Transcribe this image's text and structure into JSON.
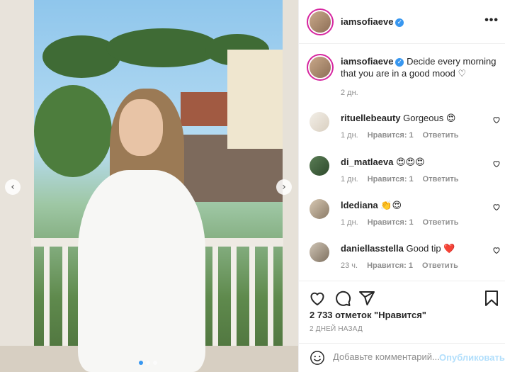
{
  "post": {
    "author": "iamsofiaeve",
    "verified_glyph": "✓",
    "more_glyph": "•••",
    "caption": "Decide every morning that you are in a good mood ♡",
    "caption_time": "2 дн."
  },
  "comments": [
    {
      "user": "rituellebeauty",
      "text": "Gorgeous 😍",
      "time": "1 дн.",
      "likes": "Нравится: 1",
      "reply": "Ответить"
    },
    {
      "user": "di_matlaeva",
      "text": "😍😍😍",
      "time": "1 дн.",
      "likes": "Нравится: 1",
      "reply": "Ответить"
    },
    {
      "user": "ldediana",
      "text": "👏😍",
      "time": "1 дн.",
      "likes": "Нравится: 1",
      "reply": "Ответить"
    },
    {
      "user": "daniellasstella",
      "text": "Good tip ❤️",
      "time": "23 ч.",
      "likes": "Нравится: 1",
      "reply": "Ответить"
    }
  ],
  "stats": {
    "likes_label": "2 733 отметок \"Нравится\"",
    "date_label": "2 ДНЕЙ НАЗАД"
  },
  "composer": {
    "placeholder": "Добавьте комментарий...",
    "post_label": "Опубликовать"
  },
  "carousel": {
    "prev_glyph": "‹",
    "next_glyph": "›",
    "slide_count": 3,
    "active_slide": 1
  },
  "colors": {
    "accent": "#3897f0",
    "post_disabled": "#b2dffc",
    "muted": "#8e8e8e",
    "text": "#262626",
    "heart_red": "#ed4956"
  },
  "icons": [
    "heart-icon",
    "comment-icon",
    "share-icon",
    "bookmark-icon",
    "emoji-icon",
    "more-icon",
    "chevron-left-icon",
    "chevron-right-icon"
  ]
}
